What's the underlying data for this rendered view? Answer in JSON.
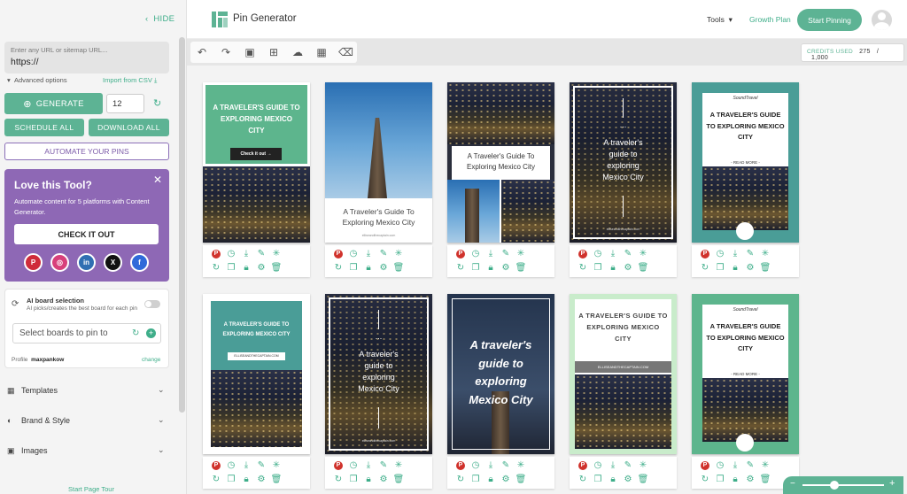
{
  "sidebar": {
    "hide_label": "HIDE",
    "url_placeholder": "Enter any URL or sitemap URL...",
    "url_value": "https://",
    "advanced_options": "Advanced options",
    "import_csv": "Import from CSV",
    "generate_label": "GENERATE",
    "count_value": "12",
    "schedule_all": "SCHEDULE ALL",
    "download_all": "DOWNLOAD ALL",
    "automate": "AUTOMATE YOUR PINS",
    "promo": {
      "title": "Love this Tool?",
      "text": "Automate content for 5 platforms with Content Generator.",
      "button": "CHECK IT OUT",
      "socials": [
        "pinterest-icon",
        "instagram-icon",
        "linkedin-icon",
        "x-icon",
        "facebook-icon"
      ]
    },
    "ai_board": {
      "title": "AI board selection",
      "subtitle": "AI picks/creates the best board for each pin",
      "boards_placeholder": "Select boards to pin to",
      "profile_label": "Profile",
      "profile_value": "maxpankow",
      "change": "change"
    },
    "sections": [
      {
        "label": "Templates",
        "icon": "grid-icon"
      },
      {
        "label": "Brand & Style",
        "icon": "palette-icon"
      },
      {
        "label": "Images",
        "icon": "image-icon"
      }
    ],
    "tour": "Start Page Tour"
  },
  "header": {
    "brand": "Pin Generator",
    "tools": "Tools",
    "growth_plan": "Growth Plan",
    "start_pinning": "Start Pinning"
  },
  "toolbar": {
    "icons": [
      "undo-icon",
      "redo-icon",
      "save-icon",
      "add-pin-icon",
      "cloud-upload-icon",
      "calendar-icon",
      "eraser-icon"
    ],
    "credits_label": "CREDITS USED",
    "credits_used": "275",
    "credits_sep": "/",
    "credits_total": "1,000"
  },
  "pins": {
    "p1_title": "A TRAVELER'S GUIDE TO EXPLORING MEXICO CITY",
    "p1_cta": "Check it out →",
    "p2_title": "A Traveler's Guide To Exploring Mexico City",
    "p2_url": "elliseandthecaptain.com",
    "p3_title": "A Traveler's Guide To Exploring Mexico City",
    "p4_dots": "...",
    "p4_title": "A traveler's guide to exploring Mexico City",
    "p4_url": "elliseandthecaptain.com",
    "p5_brand": "SoundTravel",
    "p5_title": "A TRAVELER'S GUIDE TO EXPLORING MEXICO CITY",
    "p5_cta": "- READ MORE -",
    "p6_title": "A TRAVELER'S GUIDE TO EXPLORING MEXICO CITY",
    "p6_url": "ELLISEANDTHECAPTAIN.COM",
    "p7_dots": "...",
    "p7_title": "A traveler's guide to exploring Mexico City",
    "p7_url": "elliseandthecaptain.com",
    "p8_title": "A traveler's guide to exploring Mexico City",
    "p9_title": "A TRAVELER'S GUIDE TO EXPLORING MEXICO CITY",
    "p9_url": "ELLISEANDTHECAPTAIN.COM",
    "p10_brand": "SoundTravel",
    "p10_title": "A TRAVELER'S GUIDE TO EXPLORING MEXICO CITY",
    "p10_cta": "- READ MORE -"
  },
  "pin_actions": {
    "row1": [
      "pinterest-icon",
      "clock-icon",
      "download-icon",
      "edit-icon",
      "sparkle-icon"
    ],
    "row2": [
      "refresh-icon",
      "copy-icon",
      "lock-icon",
      "settings-icon",
      "trash-icon"
    ],
    "pinterest_glyph": "P"
  },
  "colors": {
    "accent": "#5db394",
    "promo": "#8e68b5",
    "pinterest": "#d0322c",
    "teal": "#4a9d97"
  }
}
